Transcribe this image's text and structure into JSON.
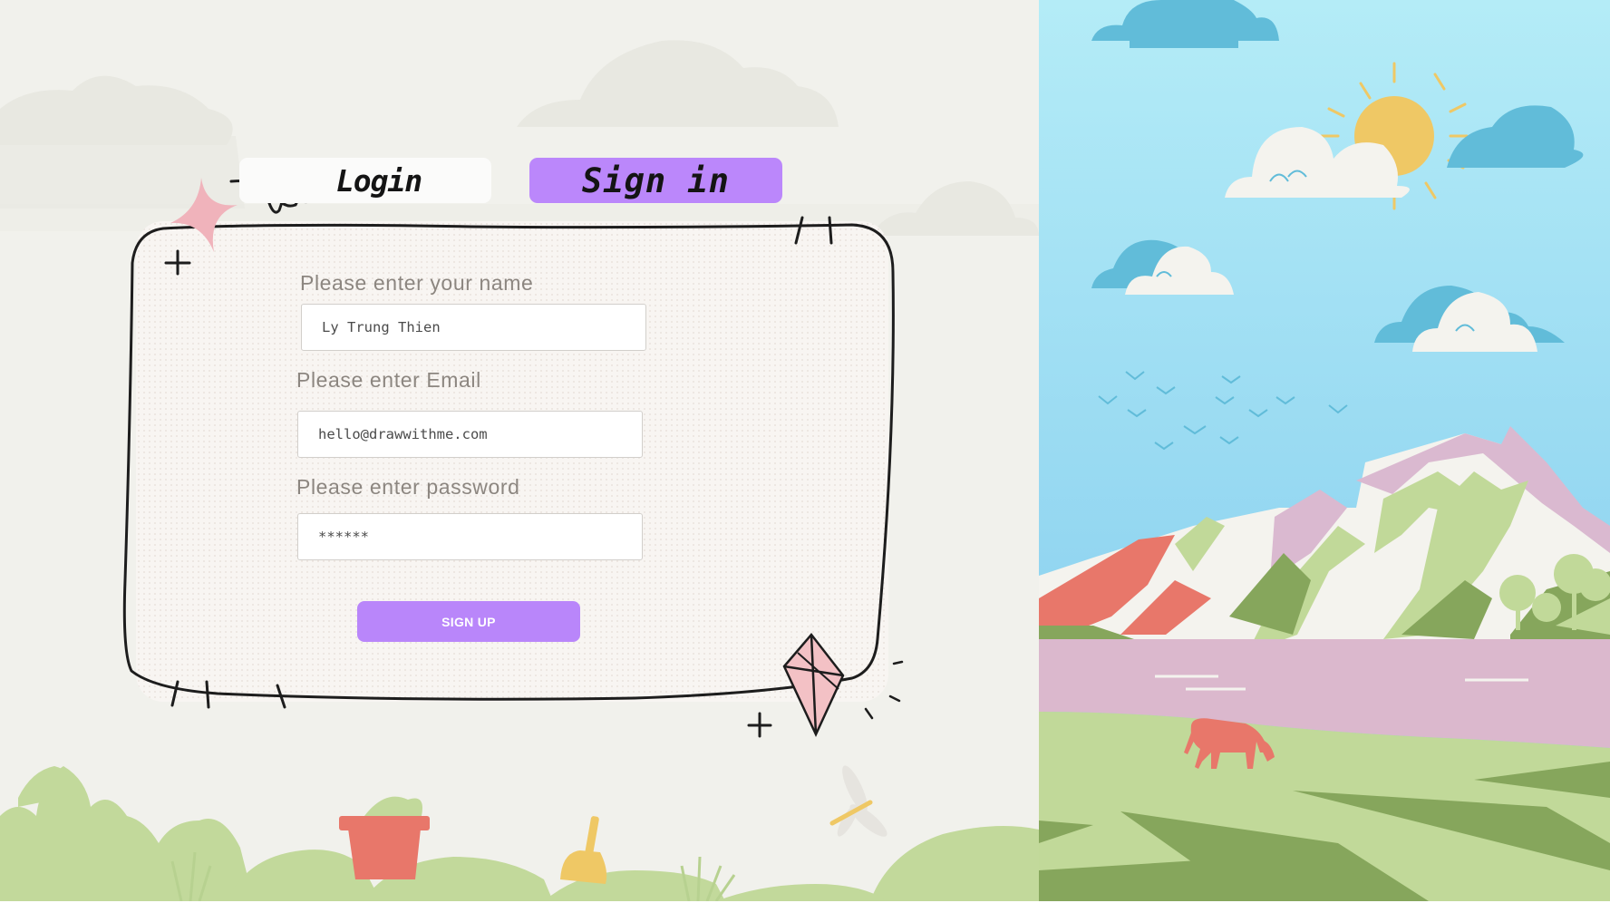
{
  "tabs": {
    "login_label": "Login",
    "signin_label": "Sign in"
  },
  "form": {
    "name_label": "Please enter your name",
    "name_value": "Ly Trung Thien",
    "email_label": "Please enter Email",
    "email_value": "hello@drawwithme.com",
    "password_label": "Please enter password",
    "password_value": "******",
    "submit_label": "SIGN UP"
  },
  "colors": {
    "accent": "#bb87fb",
    "left_background": "#f1f1ec",
    "card_background": "#f8f5f2",
    "sky": "#8fd4f0",
    "cloud_blue": "#61bcd9",
    "sun": "#efc865",
    "mountain_green": "#c1d999",
    "mountain_pink": "#dab9d0",
    "coral": "#e8776a",
    "lake": "#dbb8cd"
  },
  "icons": {
    "sparkle": "pink-sparkle-icon",
    "scribble": "scribble-loop-icon",
    "kite": "kite-icon",
    "bucket": "bucket-icon",
    "shovel": "shovel-icon",
    "dragonfly": "dragonfly-icon",
    "sun": "sun-icon",
    "cow": "cow-icon"
  }
}
